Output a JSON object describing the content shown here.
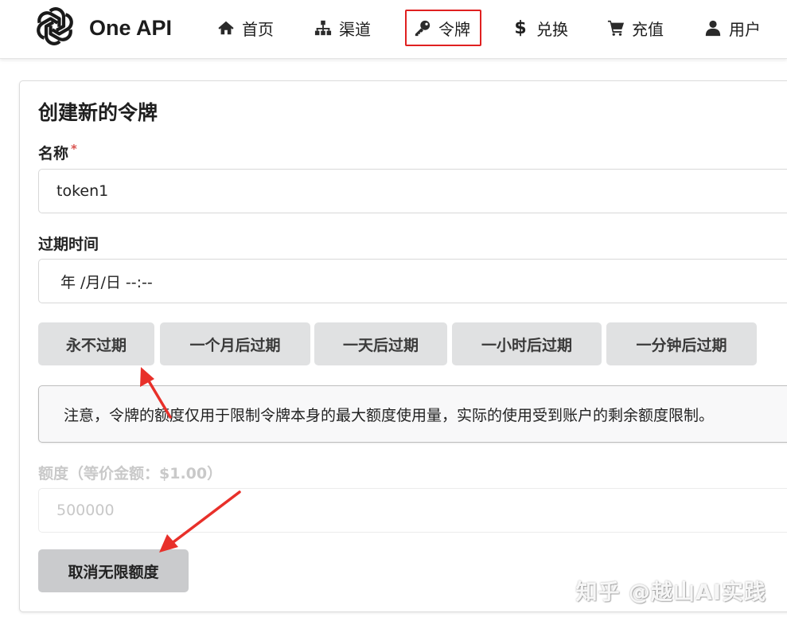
{
  "brand": {
    "name": "One API",
    "logo_icon": "openai-logo-icon"
  },
  "nav": {
    "items": [
      {
        "label": "首页",
        "icon": "home-icon"
      },
      {
        "label": "渠道",
        "icon": "sitemap-icon"
      },
      {
        "label": "令牌",
        "icon": "key-icon",
        "active": true
      },
      {
        "label": "兑换",
        "icon": "dollar-icon"
      },
      {
        "label": "充值",
        "icon": "cart-icon"
      },
      {
        "label": "用户",
        "icon": "user-icon"
      }
    ],
    "active_color": "#e02020"
  },
  "form": {
    "title": "创建新的令牌",
    "name_label": "名称",
    "required_mark": "*",
    "name_value": "token1",
    "expire_label": "过期时间",
    "expire_value": "年 /月/日 --:--",
    "expire_buttons": [
      "永不过期",
      "一个月后过期",
      "一天后过期",
      "一小时后过期",
      "一分钟后过期"
    ],
    "notice": "注意，令牌的额度仅用于限制令牌本身的最大额度使用量，实际的使用受到账户的剩余额度限制。",
    "quota_label": "额度（等价金额：$1.00）",
    "quota_value": "500000",
    "unlimited_button": "取消无限额度"
  },
  "watermark": "知乎 @越山AI实践",
  "annotation_color": "#e8302a"
}
